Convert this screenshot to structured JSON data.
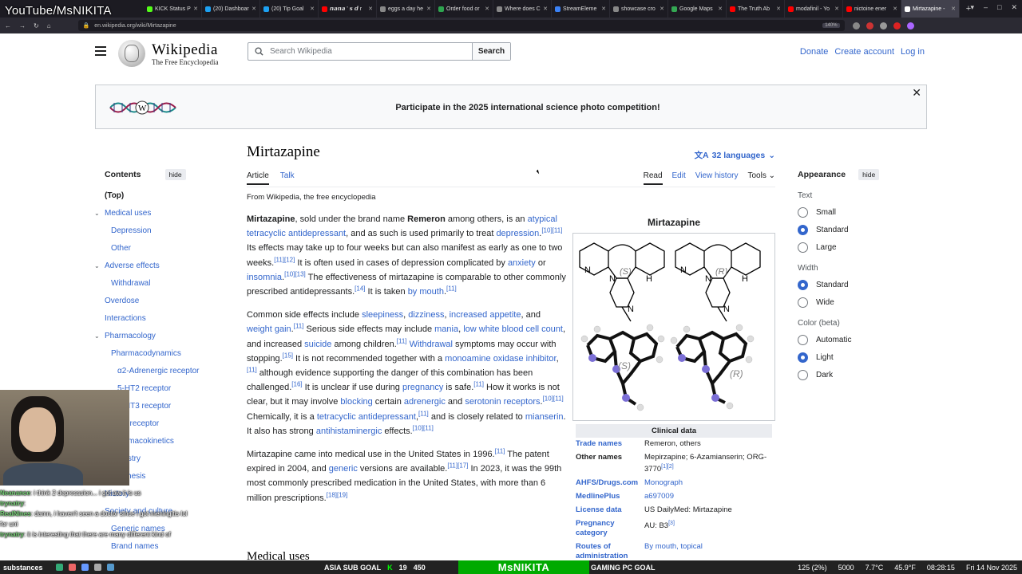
{
  "overlay": {
    "watermark": "YouTube/MsNIKITA"
  },
  "browser": {
    "tabs": [
      {
        "label": "KICK Status P",
        "color": "#53fc18",
        "active": false
      },
      {
        "label": "(20) Dashboar",
        "color": "#1da1f2",
        "active": false
      },
      {
        "label": "(20) Tip Goal",
        "color": "#1da1f2",
        "active": false
      },
      {
        "label": "𝙣𝙖𝙣𝙖 ' 𝙨 𝙙 r",
        "color": "#ff0000",
        "active": false
      },
      {
        "label": "eggs a day he",
        "color": "#888888",
        "active": false
      },
      {
        "label": "Order food or",
        "color": "#2ea44f",
        "active": false
      },
      {
        "label": "Where does C",
        "color": "#888888",
        "active": false
      },
      {
        "label": "StreamEleme",
        "color": "#3b82f6",
        "active": false
      },
      {
        "label": "showcase cro",
        "color": "#888888",
        "active": false
      },
      {
        "label": "Google Maps",
        "color": "#34a853",
        "active": false
      },
      {
        "label": "The Truth Ab",
        "color": "#ff0000",
        "active": false
      },
      {
        "label": "modafinil - Yo",
        "color": "#ff0000",
        "active": false
      },
      {
        "label": "nictoine ener",
        "color": "#ff0000",
        "active": false
      },
      {
        "label": "Mirtazapine -",
        "color": "#ffffff",
        "active": true
      }
    ],
    "url": "en.wikipedia.org/wiki/Mirtazapine",
    "zoom": "140%"
  },
  "wiki": {
    "wordmark_title": "Wikipedia",
    "wordmark_tagline": "The Free Encyclopedia",
    "search_placeholder": "Search Wikipedia",
    "search_button": "Search",
    "toplinks": {
      "donate": "Donate",
      "create_account": "Create account",
      "login": "Log in"
    },
    "banner": "Participate in the 2025 international science photo competition!"
  },
  "toc": {
    "title": "Contents",
    "hide": "hide",
    "items": [
      {
        "label": "(Top)",
        "level": 1,
        "top": true
      },
      {
        "label": "Medical uses",
        "level": 1,
        "chev": true
      },
      {
        "label": "Depression",
        "level": 2
      },
      {
        "label": "Other",
        "level": 2
      },
      {
        "label": "Adverse effects",
        "level": 1,
        "chev": true
      },
      {
        "label": "Withdrawal",
        "level": 2
      },
      {
        "label": "Overdose",
        "level": 1
      },
      {
        "label": "Interactions",
        "level": 1
      },
      {
        "label": "Pharmacology",
        "level": 1,
        "chev": true
      },
      {
        "label": "Pharmacodynamics",
        "level": 2
      },
      {
        "label": "α2-Adrenergic receptor",
        "level": 3
      },
      {
        "label": "5-HT2 receptor",
        "level": 3
      },
      {
        "label": "5-HT3 receptor",
        "level": 3
      },
      {
        "label": "H1 receptor",
        "level": 3
      },
      {
        "label": "Pharmacokinetics",
        "level": 2
      },
      {
        "label": "Chemistry",
        "level": 1
      },
      {
        "label": "Synthesis",
        "level": 2
      },
      {
        "label": "History",
        "level": 1
      },
      {
        "label": "Society and culture",
        "level": 1,
        "chev": true
      },
      {
        "label": "Generic names",
        "level": 2
      },
      {
        "label": "Brand names",
        "level": 2
      }
    ]
  },
  "article": {
    "title": "Mirtazapine",
    "languages": "32 languages",
    "tabs_left": [
      "Article",
      "Talk"
    ],
    "tabs_right": [
      "Read",
      "Edit",
      "View history",
      "Tools"
    ],
    "from": "From Wikipedia, the free encyclopedia",
    "next_heading": "Medical uses"
  },
  "infobox": {
    "title": "Mirtazapine",
    "section": "Clinical data",
    "image_labels": {
      "s": "(S)",
      "r": "(R)",
      "n": "N",
      "h": "H"
    },
    "rows": [
      {
        "k": "Trade names",
        "v": "Remeron, others",
        "klink": true
      },
      {
        "k": "Other names",
        "v": "Mepirzapine; 6-Azamianserin; ORG-3770",
        "sup": "[1][2]"
      },
      {
        "k": "AHFS/Drugs.com",
        "v": "Monograph",
        "klink": true,
        "vlink": true
      },
      {
        "k": "MedlinePlus",
        "v": "a697009",
        "klink": true,
        "vlink": true
      },
      {
        "k": "License data",
        "v": "US DailyMed: Mirtazapine",
        "klink": true
      },
      {
        "k": "Pregnancy category",
        "v": "AU: B3",
        "sup": "[3]",
        "klink": true
      },
      {
        "k": "Routes of administration",
        "v": "By mouth, topical",
        "klink": true,
        "vlink": true
      }
    ]
  },
  "appearance": {
    "title": "Appearance",
    "hide": "hide",
    "groups": [
      {
        "label": "Text",
        "options": [
          {
            "label": "Small",
            "on": false
          },
          {
            "label": "Standard",
            "on": true
          },
          {
            "label": "Large",
            "on": false
          }
        ]
      },
      {
        "label": "Width",
        "options": [
          {
            "label": "Standard",
            "on": true
          },
          {
            "label": "Wide",
            "on": false
          }
        ]
      },
      {
        "label": "Color (beta)",
        "options": [
          {
            "label": "Automatic",
            "on": false
          },
          {
            "label": "Light",
            "on": true
          },
          {
            "label": "Dark",
            "on": false
          }
        ]
      }
    ]
  },
  "chat": [
    {
      "user": "Neanance",
      "msg": ": i think 2 depresssion... i got aw it is us"
    },
    {
      "user": "trynatry",
      "msg": ":"
    },
    {
      "user": "RealNines",
      "msg": ": damn, i haven't seen a doctor since i got meningitis lol"
    },
    {
      "user": "",
      "msg": "for uni"
    },
    {
      "user": "trynatry",
      "msg": ": it is interesting that there are many different kind of"
    }
  ],
  "taskbar": {
    "start": "substances",
    "goal_label": "ASIA SUB GOAL",
    "goal_current": "19",
    "goal_target": "450",
    "brand": "MsNIKITA",
    "gaming": "GAMING PC GOAL",
    "tray": [
      "125 (2%)",
      "5000",
      "7.7°C",
      "45.9°F",
      "08:28:15",
      "Fri 14 Nov 2025"
    ]
  }
}
